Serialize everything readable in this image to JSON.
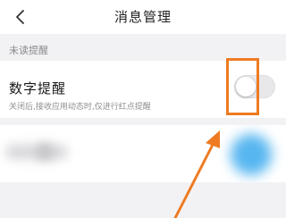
{
  "header": {
    "title": "消息管理",
    "back_icon": "chevron-left-icon"
  },
  "section": {
    "label": "未读提醒"
  },
  "setting": {
    "title": "数字提醒",
    "description": "关闭后,接收应用动态时,仅进行红点提醒",
    "toggle_on": false
  },
  "annotation": {
    "color": "#ee7b22"
  }
}
